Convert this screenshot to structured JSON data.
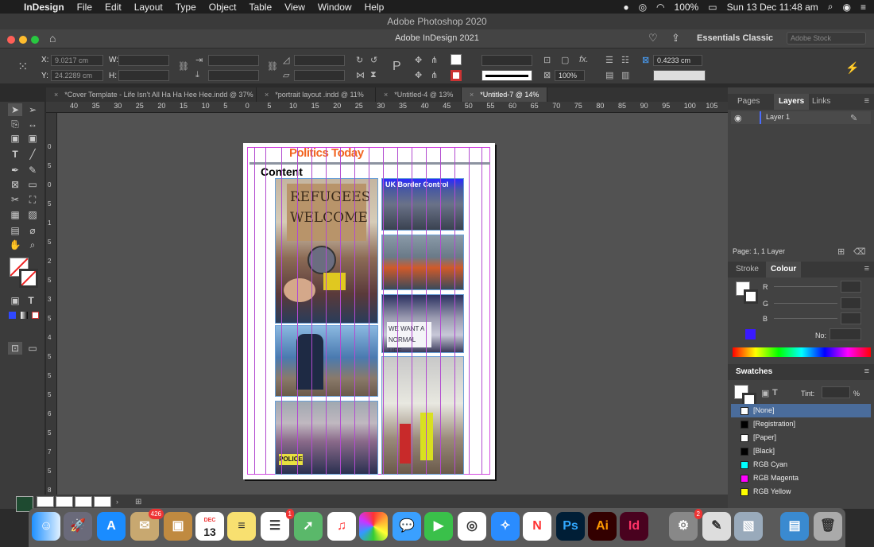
{
  "menubar": {
    "apple": "",
    "app": "InDesign",
    "items": [
      "File",
      "Edit",
      "Layout",
      "Type",
      "Object",
      "Table",
      "View",
      "Window",
      "Help"
    ],
    "battery": "100%",
    "datetime": "Sun 13 Dec  11:48 am"
  },
  "window_title": "Adobe Photoshop 2020",
  "app_title": "Adobe InDesign 2021",
  "workspace": "Essentials Classic",
  "stock_placeholder": "Adobe Stock",
  "control": {
    "x_label": "X:",
    "x_value": "9.0217 cm",
    "y_label": "Y:",
    "y_value": "24.2289 cm",
    "w_label": "W:",
    "h_label": "H:",
    "zoom": "100%",
    "stroke_weight": "0.4233 cm"
  },
  "tabs": [
    {
      "label": "*Cover Template - Life Isn't All Ha Ha Hee Hee.indd @ 37%",
      "active": false
    },
    {
      "label": "*portrait layout .indd @ 11%",
      "active": false
    },
    {
      "label": "*Untitled-4 @ 13%",
      "active": false
    },
    {
      "label": "*Untitled-7 @ 14%",
      "active": true
    }
  ],
  "ruler_h": [
    "40",
    "35",
    "30",
    "25",
    "20",
    "15",
    "10",
    "5",
    "0",
    "5",
    "10",
    "15",
    "20",
    "25",
    "30",
    "35",
    "40",
    "45",
    "50",
    "55",
    "60",
    "65",
    "70",
    "75",
    "80",
    "85",
    "90",
    "95",
    "100",
    "105"
  ],
  "ruler_v": [
    "0",
    "5",
    "0",
    "5",
    "1",
    "5",
    "2",
    "5",
    "3",
    "5",
    "4",
    "5",
    "5",
    "5",
    "6",
    "5",
    "7",
    "5",
    "8"
  ],
  "document": {
    "masthead": "Politics Today",
    "heading": "Content",
    "photo1_text": "REFUGEES WELCOME",
    "photo2_text": "UK Border Control",
    "photo3_text": "WE WANT A NORMAL LIFE",
    "photo4_text": "POLICE"
  },
  "layers_panel": {
    "tabs": [
      "Pages",
      "Layers",
      "Links"
    ],
    "layer": "Layer 1",
    "status": "Page: 1, 1 Layer"
  },
  "colour_panel": {
    "tabs": [
      "Stroke",
      "Colour"
    ],
    "r": "R",
    "g": "G",
    "b": "B",
    "no_label": "No:"
  },
  "swatches_panel": {
    "title": "Swatches",
    "tint_label": "Tint:",
    "tint_unit": "%",
    "items": [
      {
        "name": "[None]",
        "color": "#ffffff"
      },
      {
        "name": "[Registration]",
        "color": "#000000"
      },
      {
        "name": "[Paper]",
        "color": "#ffffff"
      },
      {
        "name": "[Black]",
        "color": "#000000"
      },
      {
        "name": "RGB Cyan",
        "color": "#00ffff"
      },
      {
        "name": "RGB Magenta",
        "color": "#ff00ff"
      },
      {
        "name": "RGB Yellow",
        "color": "#ffff00"
      }
    ]
  },
  "dock": {
    "mail_badge": "426",
    "reminders_badge": "1",
    "prefs_badge": "2",
    "calendar_month": "DEC",
    "calendar_day": "13",
    "ps": "Ps",
    "ai": "Ai",
    "id": "Id"
  },
  "colors": {
    "accent": "#f26522",
    "guide": "#b24bd0",
    "selection": "#4a6c9b"
  }
}
